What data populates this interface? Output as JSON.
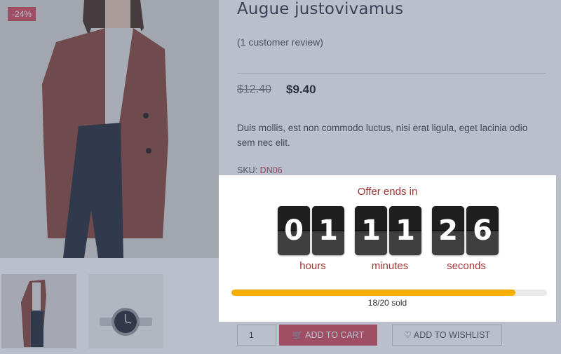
{
  "product": {
    "sale_badge": "-24%",
    "title": "Augue justovivamus",
    "reviews": "(1 customer review)",
    "old_price": "$12.40",
    "new_price": "$9.40",
    "description": "Duis mollis, est non commodo luctus, nisi erat ligula, eget lacinia odio sem nec elit.",
    "sku_label": "SKU:",
    "sku_value": "DN06",
    "quantity": "1",
    "add_to_cart": "ADD TO CART",
    "add_to_wishlist": "ADD TO WISHLIST"
  },
  "countdown": {
    "title": "Offer ends in",
    "hours": [
      "0",
      "1"
    ],
    "minutes": [
      "1",
      "1"
    ],
    "seconds": [
      "2",
      "6"
    ],
    "labels": {
      "hours": "hours",
      "minutes": "minutes",
      "seconds": "seconds"
    },
    "sold_text": "18/20 sold",
    "sold_fraction": 0.9
  },
  "colors": {
    "accent": "#d74f5e",
    "countdown_text": "#a23435",
    "progress": "#f6ae00"
  }
}
